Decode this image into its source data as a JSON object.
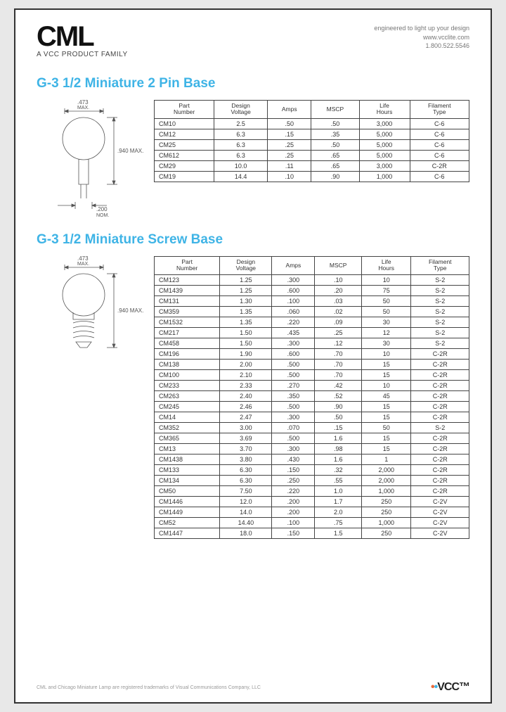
{
  "header": {
    "logo_main": "CML",
    "logo_sub": "A VCC PRODUCT FAMILY",
    "tagline": "engineered to light up your design",
    "website": "www.vcclite.com",
    "phone": "1.800.522.5546"
  },
  "section1": {
    "title": "G-3 1/2 Miniature 2 Pin Base",
    "diagram": {
      "dim1": ".473",
      "dim1_sub": "MAX.",
      "dim2": ".940 MAX.",
      "dim3": ".200",
      "dim3_sub": "NOM."
    },
    "columns": [
      "Part\nNumber",
      "Design\nVoltage",
      "Amps",
      "MSCP",
      "Life\nHours",
      "Filament\nType"
    ],
    "rows": [
      [
        "CM10",
        "2.5",
        ".50",
        ".50",
        "3,000",
        "C-6"
      ],
      [
        "CM12",
        "6.3",
        ".15",
        ".35",
        "5,000",
        "C-6"
      ],
      [
        "CM25",
        "6.3",
        ".25",
        ".50",
        "5,000",
        "C-6"
      ],
      [
        "CM612",
        "6.3",
        ".25",
        ".65",
        "5,000",
        "C-6"
      ],
      [
        "CM29",
        "10.0",
        ".11",
        ".65",
        "3,000",
        "C-2R"
      ],
      [
        "CM19",
        "14.4",
        ".10",
        ".90",
        "1,000",
        "C-6"
      ]
    ]
  },
  "section2": {
    "title": "G-3 1/2 Miniature Screw Base",
    "diagram": {
      "dim1": ".473",
      "dim1_sub": "MAX.",
      "dim2": ".940 MAX."
    },
    "columns": [
      "Part\nNumber",
      "Design\nVoltage",
      "Amps",
      "MSCP",
      "Life\nHours",
      "Filament\nType"
    ],
    "rows": [
      [
        "CM123",
        "1.25",
        ".300",
        ".10",
        "10",
        "S-2"
      ],
      [
        "CM1439",
        "1.25",
        ".600",
        ".20",
        "75",
        "S-2"
      ],
      [
        "CM131",
        "1.30",
        ".100",
        ".03",
        "50",
        "S-2"
      ],
      [
        "CM359",
        "1.35",
        ".060",
        ".02",
        "50",
        "S-2"
      ],
      [
        "CM1532",
        "1.35",
        ".220",
        ".09",
        "30",
        "S-2"
      ],
      [
        "CM217",
        "1.50",
        ".435",
        ".25",
        "12",
        "S-2"
      ],
      [
        "CM458",
        "1.50",
        ".300",
        ".12",
        "30",
        "S-2"
      ],
      [
        "CM196",
        "1.90",
        ".600",
        ".70",
        "10",
        "C-2R"
      ],
      [
        "CM138",
        "2.00",
        ".500",
        ".70",
        "15",
        "C-2R"
      ],
      [
        "CM100",
        "2.10",
        ".500",
        ".70",
        "15",
        "C-2R"
      ],
      [
        "CM233",
        "2.33",
        ".270",
        ".42",
        "10",
        "C-2R"
      ],
      [
        "CM263",
        "2.40",
        ".350",
        ".52",
        "45",
        "C-2R"
      ],
      [
        "CM245",
        "2.46",
        ".500",
        ".90",
        "15",
        "C-2R"
      ],
      [
        "CM14",
        "2.47",
        ".300",
        ".50",
        "15",
        "C-2R"
      ],
      [
        "CM352",
        "3.00",
        ".070",
        ".15",
        "50",
        "S-2"
      ],
      [
        "CM365",
        "3.69",
        ".500",
        "1.6",
        "15",
        "C-2R"
      ],
      [
        "CM13",
        "3.70",
        ".300",
        ".98",
        "15",
        "C-2R"
      ],
      [
        "CM1438",
        "3.80",
        ".430",
        "1.6",
        "1",
        "C-2R"
      ],
      [
        "CM133",
        "6.30",
        ".150",
        ".32",
        "2,000",
        "C-2R"
      ],
      [
        "CM134",
        "6.30",
        ".250",
        ".55",
        "2,000",
        "C-2R"
      ],
      [
        "CM50",
        "7.50",
        ".220",
        "1.0",
        "1,000",
        "C-2R"
      ],
      [
        "CM1446",
        "12.0",
        ".200",
        "1.7",
        "250",
        "C-2V"
      ],
      [
        "CM1449",
        "14.0",
        ".200",
        "2.0",
        "250",
        "C-2V"
      ],
      [
        "CM52",
        "14.40",
        ".100",
        ".75",
        "1,000",
        "C-2V"
      ],
      [
        "CM1447",
        "18.0",
        ".150",
        "1.5",
        "250",
        "C-2V"
      ]
    ]
  },
  "footer": {
    "legal": "CML and Chicago Miniature Lamp are registered trademarks of Visual Communications Company, LLC",
    "vcc": "VCC"
  }
}
